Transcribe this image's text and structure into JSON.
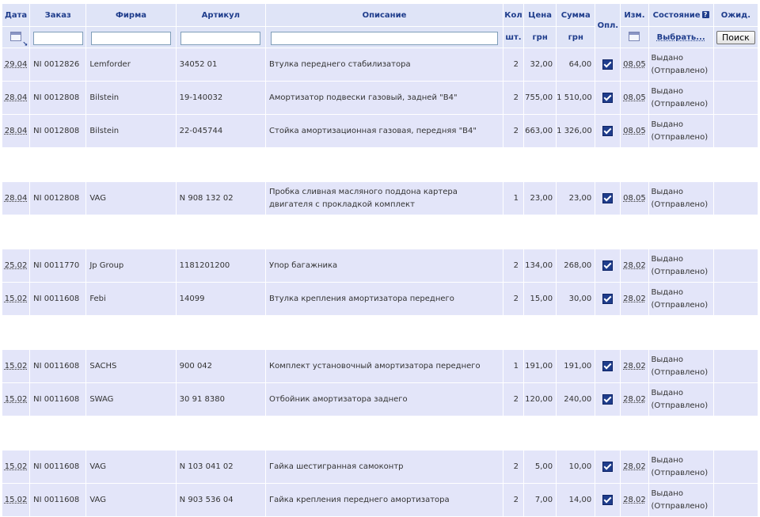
{
  "header": {
    "date": "Дата",
    "order": "Заказ",
    "brand": "Фирма",
    "article": "Артикул",
    "description": "Описание",
    "qty": "Кол",
    "qty_unit": "шт.",
    "price": "Цена",
    "price_unit": "грн",
    "sum": "Сумма",
    "sum_unit": "грн",
    "paid": "Опл.",
    "modified": "Изм.",
    "status": "Состояние",
    "status_choose": "Выбрать...",
    "wait": "Ожид.",
    "search_button": "Поиск"
  },
  "rows": [
    {
      "date": "29.04",
      "order": "NI 0012826",
      "brand": "Lemforder",
      "article": "34052 01",
      "desc": "Втулка переднего стабилизатора",
      "qty": "2",
      "price": "32,00",
      "sum": "64,00",
      "paid": true,
      "mod": "08.05",
      "status1": "Выдано",
      "status2": "(Отправлено)"
    },
    {
      "date": "28.04",
      "order": "NI 0012808",
      "brand": "Bilstein",
      "article": "19-140032",
      "desc": "Амортизатор подвески газовый, задней \"B4\"",
      "qty": "2",
      "price": "755,00",
      "sum": "1 510,00",
      "paid": true,
      "mod": "08.05",
      "status1": "Выдано",
      "status2": "(Отправлено)"
    },
    {
      "date": "28.04",
      "order": "NI 0012808",
      "brand": "Bilstein",
      "article": "22-045744",
      "desc": "Стойка амортизационная газовая, передняя \"B4\"",
      "qty": "2",
      "price": "663,00",
      "sum": "1 326,00",
      "paid": true,
      "mod": "08.05",
      "status1": "Выдано",
      "status2": "(Отправлено)"
    },
    {
      "date": "28.04",
      "order": "NI 0012808",
      "brand": "VAG",
      "article": "N 908 132 02",
      "desc": "Пробка сливная масляного поддона картера двигателя с прокладкой комплект",
      "qty": "1",
      "price": "23,00",
      "sum": "23,00",
      "paid": true,
      "mod": "08.05",
      "status1": "Выдано",
      "status2": "(Отправлено)"
    },
    {
      "date": "25.02",
      "order": "NI 0011770",
      "brand": "Jp Group",
      "article": "1181201200",
      "desc": "Упор багажника",
      "qty": "2",
      "price": "134,00",
      "sum": "268,00",
      "paid": true,
      "mod": "28.02",
      "status1": "Выдано",
      "status2": "(Отправлено)"
    },
    {
      "date": "15.02",
      "order": "NI 0011608",
      "brand": "Febi",
      "article": "14099",
      "desc": "Втулка крепления амортизатора переднего",
      "qty": "2",
      "price": "15,00",
      "sum": "30,00",
      "paid": true,
      "mod": "28.02",
      "status1": "Выдано",
      "status2": "(Отправлено)"
    },
    {
      "date": "15.02",
      "order": "NI 0011608",
      "brand": "SACHS",
      "article": "900 042",
      "desc": "Комплект установочный амортизатора переднего",
      "qty": "1",
      "price": "191,00",
      "sum": "191,00",
      "paid": true,
      "mod": "28.02",
      "status1": "Выдано",
      "status2": "(Отправлено)"
    },
    {
      "date": "15.02",
      "order": "NI 0011608",
      "brand": "SWAG",
      "article": "30 91 8380",
      "desc": "Отбойник амортизатора заднего",
      "qty": "2",
      "price": "120,00",
      "sum": "240,00",
      "paid": true,
      "mod": "28.02",
      "status1": "Выдано",
      "status2": "(Отправлено)"
    },
    {
      "date": "15.02",
      "order": "NI 0011608",
      "brand": "VAG",
      "article": "N 103 041 02",
      "desc": "Гайка шестигранная самоконтр",
      "qty": "2",
      "price": "5,00",
      "sum": "10,00",
      "paid": true,
      "mod": "28.02",
      "status1": "Выдано",
      "status2": "(Отправлено)"
    },
    {
      "date": "15.02",
      "order": "NI 0011608",
      "brand": "VAG",
      "article": "N 903 536 04",
      "desc": "Гайка крепления переднего амортизатора",
      "qty": "2",
      "price": "7,00",
      "sum": "14,00",
      "paid": true,
      "mod": "28.02",
      "status1": "Выдано",
      "status2": "(Отправлено)"
    }
  ],
  "separators_after": [
    2,
    3,
    5,
    7
  ]
}
